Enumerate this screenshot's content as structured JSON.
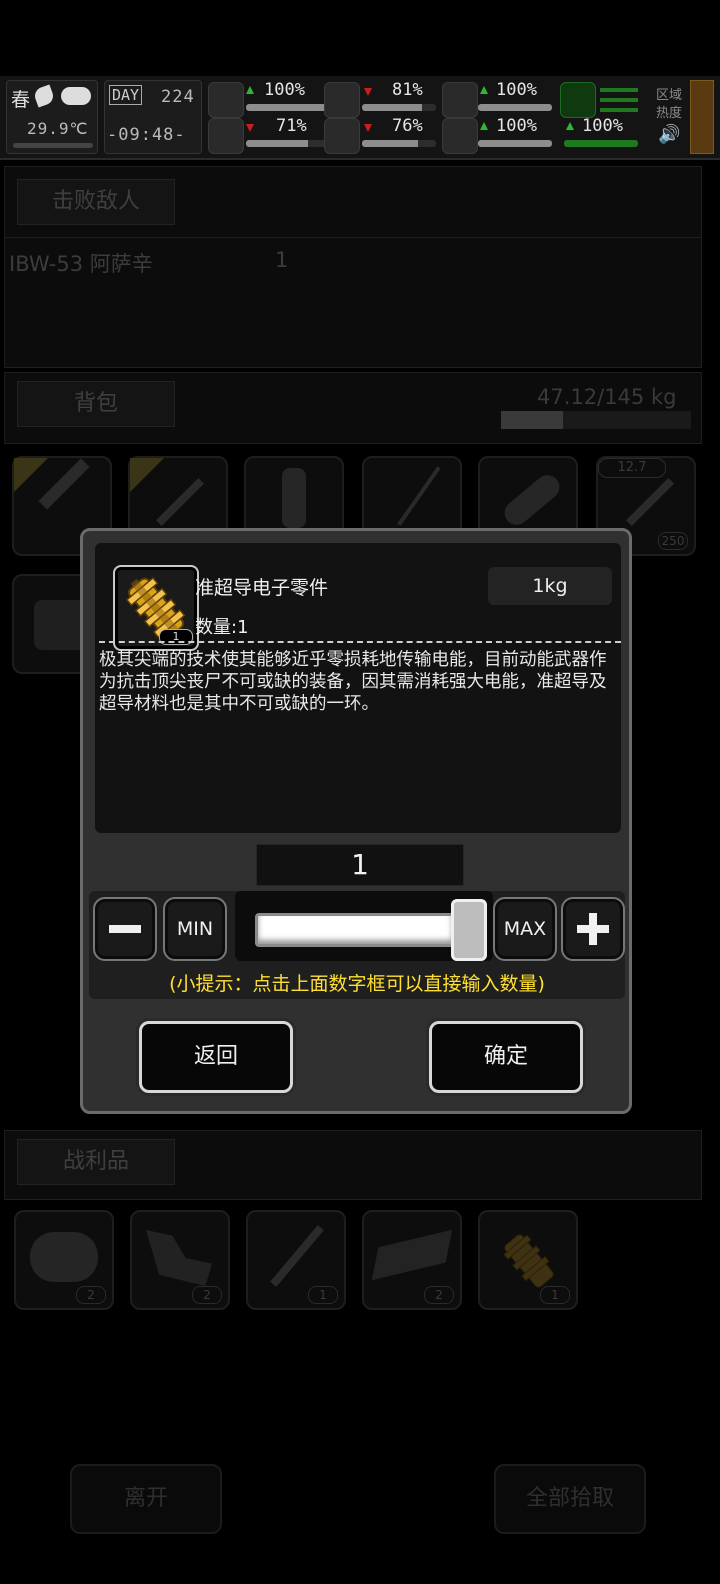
{
  "hud": {
    "season": "春",
    "temperature": "29.9℃",
    "day_label": "DAY",
    "day_number": "224",
    "clock": "-09:48-",
    "health_pct": "100%",
    "hunger_pct": "81%",
    "thirst_pct": "76%",
    "armor_pct": "100%",
    "mood_pct": "100%",
    "stamina_pct": "100%",
    "infection_pct": "71%",
    "region_heat_label_1": "区域",
    "region_heat_label_2": "热度"
  },
  "defeated": {
    "header": "击败敌人",
    "enemy_name": "IBW-53 阿萨辛",
    "enemy_count": "1"
  },
  "backpack": {
    "header": "背包",
    "weight": "47.12/145 kg",
    "weight_fraction": 0.325,
    "slots": [
      {
        "icon": "wrench-icon",
        "starred": true,
        "count": ""
      },
      {
        "icon": "shovel-icon",
        "starred": true,
        "count": ""
      },
      {
        "icon": "bottle-icon",
        "starred": false,
        "count": ""
      },
      {
        "icon": "rod-icon",
        "starred": false,
        "count": ""
      },
      {
        "icon": "bread-icon",
        "starred": false,
        "count": ""
      },
      {
        "icon": "ammo-icon",
        "starred": false,
        "count": "250",
        "tag": "12.7"
      }
    ]
  },
  "loot": {
    "header": "战利品",
    "slots": [
      {
        "icon": "rocks-icon",
        "count": "2"
      },
      {
        "icon": "scrap-metal-icon",
        "count": "2"
      },
      {
        "icon": "screws-icon",
        "count": "1"
      },
      {
        "icon": "steel-plate-icon",
        "count": "2"
      },
      {
        "icon": "superconductor-part-icon",
        "count": "1"
      }
    ]
  },
  "footer": {
    "leave": "离开",
    "take_all": "全部拾取"
  },
  "dialog": {
    "item_name": "准超导电子零件",
    "item_weight": "1kg",
    "item_qty_label": "数量:1",
    "item_qty_badge": "1",
    "description": "极其尖端的技术使其能够近乎零损耗地传输电能，目前动能武器作为抗击顶尖丧尸不可或缺的装备，因其需消耗强大电能，准超导及超导材料也是其中不可或缺的一环。",
    "quantity_value": "1",
    "min_label": "MIN",
    "max_label": "MAX",
    "slider_fraction": 1.0,
    "hint": "(小提示：点击上面数字框可以直接输入数量)",
    "back": "返回",
    "confirm": "确定"
  },
  "colors": {
    "accent_yellow": "#ffe032",
    "status_green": "#2db82d",
    "status_red": "#c81e1e",
    "gold": "#d9a21b"
  }
}
